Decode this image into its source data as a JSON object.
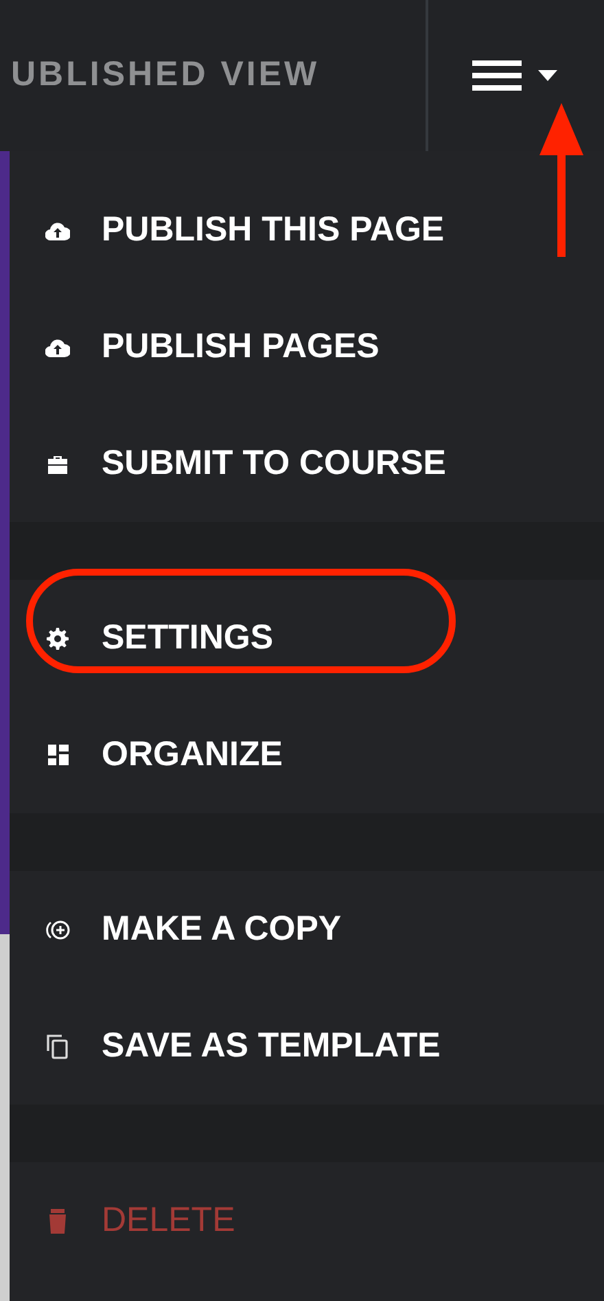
{
  "header": {
    "title": "UBLISHED VIEW",
    "menu_pointed_at": true
  },
  "menu_groups": [
    {
      "items": [
        {
          "label": "PUBLISH THIS PAGE",
          "kind": "cloud",
          "highlighted": false,
          "danger": false
        },
        {
          "label": "PUBLISH PAGES",
          "kind": "cloud",
          "highlighted": false,
          "danger": false
        },
        {
          "label": "SUBMIT TO COURSE",
          "kind": "briefcase",
          "highlighted": false,
          "danger": false
        }
      ]
    },
    {
      "items": [
        {
          "label": "SETTINGS",
          "kind": "gear",
          "highlighted": true,
          "danger": false
        },
        {
          "label": "ORGANIZE",
          "kind": "grid",
          "highlighted": false,
          "danger": false
        }
      ]
    },
    {
      "items": [
        {
          "label": "MAKE A COPY",
          "kind": "copy",
          "highlighted": false,
          "danger": false
        },
        {
          "label": "SAVE AS TEMPLATE",
          "kind": "template",
          "highlighted": false,
          "danger": false
        }
      ]
    },
    {
      "items": [
        {
          "label": "DELETE",
          "kind": "delete",
          "highlighted": false,
          "danger": true
        }
      ]
    }
  ]
}
